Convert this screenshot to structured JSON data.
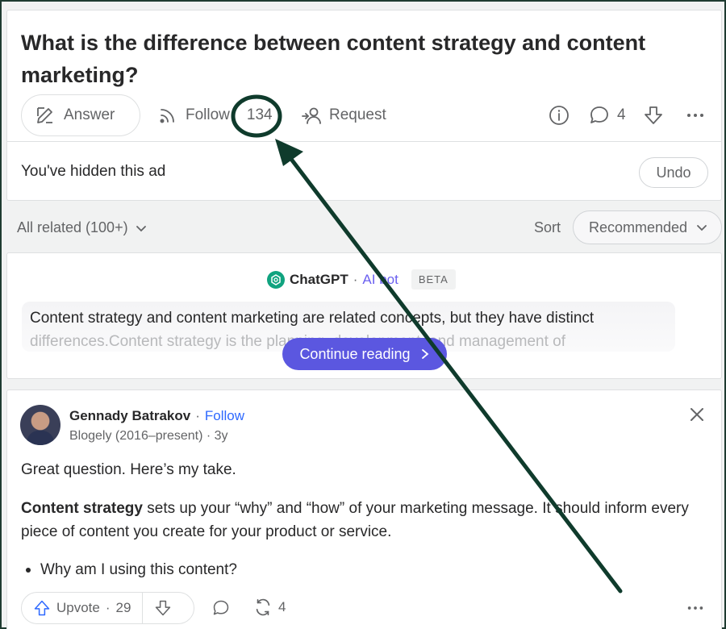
{
  "question": {
    "title": "What is the difference between content strategy and content marketing?",
    "answer_label": "Answer",
    "follow_label": "Follow",
    "follow_count": "134",
    "request_label": "Request",
    "comment_count": "4"
  },
  "hidden_ad": {
    "message": "You've hidden this ad",
    "undo_label": "Undo"
  },
  "related": {
    "label": "All related (100+)",
    "sort_label": "Sort",
    "sort_value": "Recommended"
  },
  "ai_answer": {
    "name": "ChatGPT",
    "sep": "·",
    "bot_label": "AI bot",
    "beta_label": "BETA",
    "line1": "Content strategy and content marketing are related concepts, but they have distinct",
    "line2": "differences.Content strategy is the planning, development, and management of",
    "continue_label": "Continue reading"
  },
  "answer": {
    "author": "Gennady Batrakov",
    "sep": "·",
    "follow_label": "Follow",
    "credential": "Blogely (2016–present) · 3y",
    "intro": "Great question. Here’s my take.",
    "bold_term": "Content strategy",
    "body": " sets up your “why” and “how” of your marketing message. It should inform every piece of content you create for your product or service.",
    "bullet": "Why am I using this content?",
    "upvote_label": "Upvote",
    "upvote_sep": "·",
    "upvote_count": "29",
    "share_count": "4"
  },
  "icons": {
    "answer": "pencil-edit-icon",
    "follow": "rss-feed-icon",
    "request": "person-add-icon",
    "info": "info-circle-icon",
    "comment": "speech-bubble-icon",
    "downvote": "arrow-down-icon",
    "more": "ellipsis-icon",
    "chevron": "chevron-down-icon",
    "chatgpt": "openai-logo-icon",
    "close": "close-icon",
    "upvote": "arrow-up-icon",
    "share": "reshare-icon"
  },
  "colors": {
    "accent_purple": "#5b57e0",
    "link_blue": "#2e69ff",
    "annotation": "#0f3b2c",
    "upvote_blue": "#2e69ff"
  }
}
